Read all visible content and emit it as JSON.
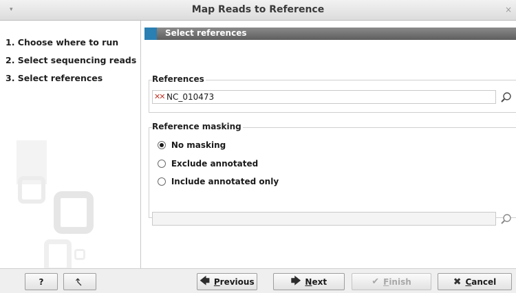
{
  "window": {
    "title": "Map Reads to Reference",
    "menu_glyph": "▾",
    "close_glyph": "×"
  },
  "steps": [
    {
      "label": "1. Choose where to run"
    },
    {
      "label": "2. Select sequencing reads"
    },
    {
      "label": "3. Select references"
    }
  ],
  "section": {
    "title": "Select references",
    "accent_color": "#2a7fb3"
  },
  "references": {
    "group_label": "References",
    "value": "NC_010473",
    "icon": "sequence-icon",
    "browse_icon": "browse-icon"
  },
  "masking": {
    "group_label": "Reference masking",
    "options": [
      {
        "label": "No masking",
        "checked": true
      },
      {
        "label": "Exclude annotated",
        "checked": false
      },
      {
        "label": "Include annotated only",
        "checked": false
      }
    ],
    "annotation_field_value": "",
    "browse_icon": "browse-icon"
  },
  "footer": {
    "help_label": "?",
    "reset_icon": "reset-icon",
    "previous": {
      "pre": "",
      "underline": "P",
      "post": "revious"
    },
    "next": {
      "pre": "",
      "underline": "N",
      "post": "ext"
    },
    "finish": {
      "pre": "",
      "underline": "F",
      "post": "inish",
      "enabled": false
    },
    "cancel": {
      "pre": "",
      "underline": "C",
      "post": "ancel"
    }
  }
}
